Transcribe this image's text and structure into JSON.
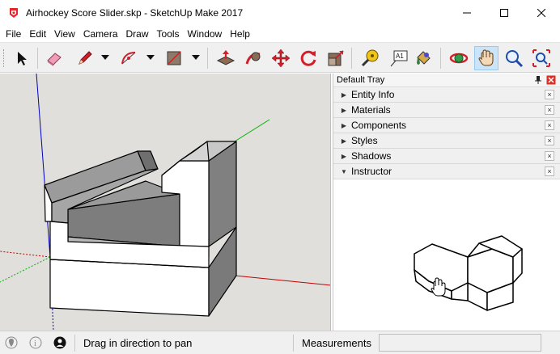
{
  "window": {
    "title": "Airhockey Score Slider.skp - SketchUp Make 2017",
    "app_icon": "sketchup-logo-icon",
    "buttons": [
      "minimize-icon",
      "maximize-icon",
      "close-icon"
    ]
  },
  "menu": {
    "items": [
      "File",
      "Edit",
      "View",
      "Camera",
      "Draw",
      "Tools",
      "Window",
      "Help"
    ]
  },
  "toolbar": {
    "tools": [
      "select-icon",
      "eraser-icon",
      "pencil-icon",
      "arc-icon",
      "rectangle-icon",
      "push-pull-icon",
      "follow-me-icon",
      "move-icon",
      "rotate-icon",
      "scale-icon",
      "tape-measure-icon",
      "text-icon",
      "paint-bucket-icon",
      "orbit-icon",
      "pan-icon",
      "zoom-icon",
      "zoom-extents-icon"
    ],
    "active_tool": "pan-icon"
  },
  "tray": {
    "title": "Default Tray",
    "panels": [
      {
        "label": "Entity Info",
        "expanded": false
      },
      {
        "label": "Materials",
        "expanded": false
      },
      {
        "label": "Components",
        "expanded": false
      },
      {
        "label": "Styles",
        "expanded": false
      },
      {
        "label": "Shadows",
        "expanded": false
      },
      {
        "label": "Instructor",
        "expanded": true
      }
    ],
    "close_glyph": "×"
  },
  "status": {
    "hint": "Drag in direction to pan",
    "measurements_label": "Measurements",
    "measurements_value": ""
  },
  "colors": {
    "viewport_bg": "#e0dfdb",
    "axis_red": "#c00000",
    "axis_green": "#00b000",
    "axis_blue": "#0000c0",
    "active_tool_bg": "#cce4f7"
  }
}
